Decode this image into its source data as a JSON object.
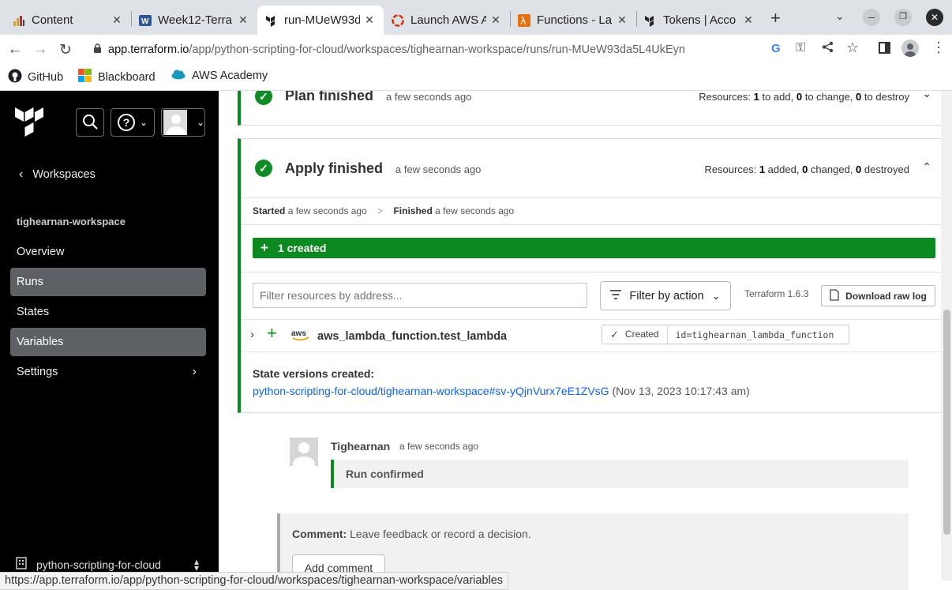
{
  "browser": {
    "tabs": [
      {
        "title": "Content",
        "icon": "chart-favicon"
      },
      {
        "title": "Week12-Terra",
        "icon": "word-favicon"
      },
      {
        "title": "run-MUeW93d",
        "icon": "terraform-favicon"
      },
      {
        "title": "Launch AWS A",
        "icon": "aws-academy-favicon"
      },
      {
        "title": "Functions - La",
        "icon": "lambda-favicon"
      },
      {
        "title": "Tokens | Acco",
        "icon": "terraform-favicon"
      }
    ],
    "url_host": "app.terraform.io",
    "url_path": "/app/python-scripting-for-cloud/workspaces/tighearnan-workspace/runs/run-MUeW93da5L4UkEyn",
    "bookmarks": [
      "GitHub",
      "Blackboard",
      "AWS Academy"
    ]
  },
  "sidebar": {
    "back_label": "Workspaces",
    "workspace_name": "tighearnan-workspace",
    "items": [
      "Overview",
      "Runs",
      "States",
      "Variables",
      "Settings"
    ],
    "organization": "python-scripting-for-cloud"
  },
  "plan": {
    "title": "Plan finished",
    "time": "a few seconds ago",
    "resources_label": "Resources:",
    "add": "1",
    "add_label": "to add,",
    "change": "0",
    "change_label": "to change,",
    "destroy": "0",
    "destroy_label": "to destroy"
  },
  "apply": {
    "title": "Apply finished",
    "time": "a few seconds ago",
    "resources_label": "Resources:",
    "added": "1",
    "added_label": "added,",
    "changed": "0",
    "changed_label": "changed,",
    "destroyed": "0",
    "destroyed_label": "destroyed",
    "started_label": "Started",
    "started_time": "a few seconds ago",
    "finished_label": "Finished",
    "finished_time": "a few seconds ago",
    "created_bar": "1 created",
    "filter_placeholder": "Filter resources by address...",
    "filter_action": "Filter by action",
    "tf_version": "Terraform 1.6.3",
    "download": "Download raw log",
    "resource_name": "aws_lambda_function.test_lambda",
    "resource_status": "Created",
    "resource_id": "id=tighearnan_lambda_function",
    "state_label": "State versions created:",
    "state_link": "python-scripting-for-cloud/tighearnan-workspace#sv-yQjnVurx7eE1ZVsG",
    "state_date": "(Nov 13, 2023 10:17:43 am)"
  },
  "comment_event": {
    "user": "Tighearnan",
    "time": "a few seconds ago",
    "message": "Run confirmed"
  },
  "comment_box": {
    "label": "Comment:",
    "hint": "Leave feedback or record a decision.",
    "button": "Add comment"
  },
  "status_url": "https://app.terraform.io/app/python-scripting-for-cloud/workspaces/tighearnan-workspace/variables",
  "colors": {
    "success": "#108c27",
    "link": "#1060ff",
    "sidebar": "#000000"
  }
}
